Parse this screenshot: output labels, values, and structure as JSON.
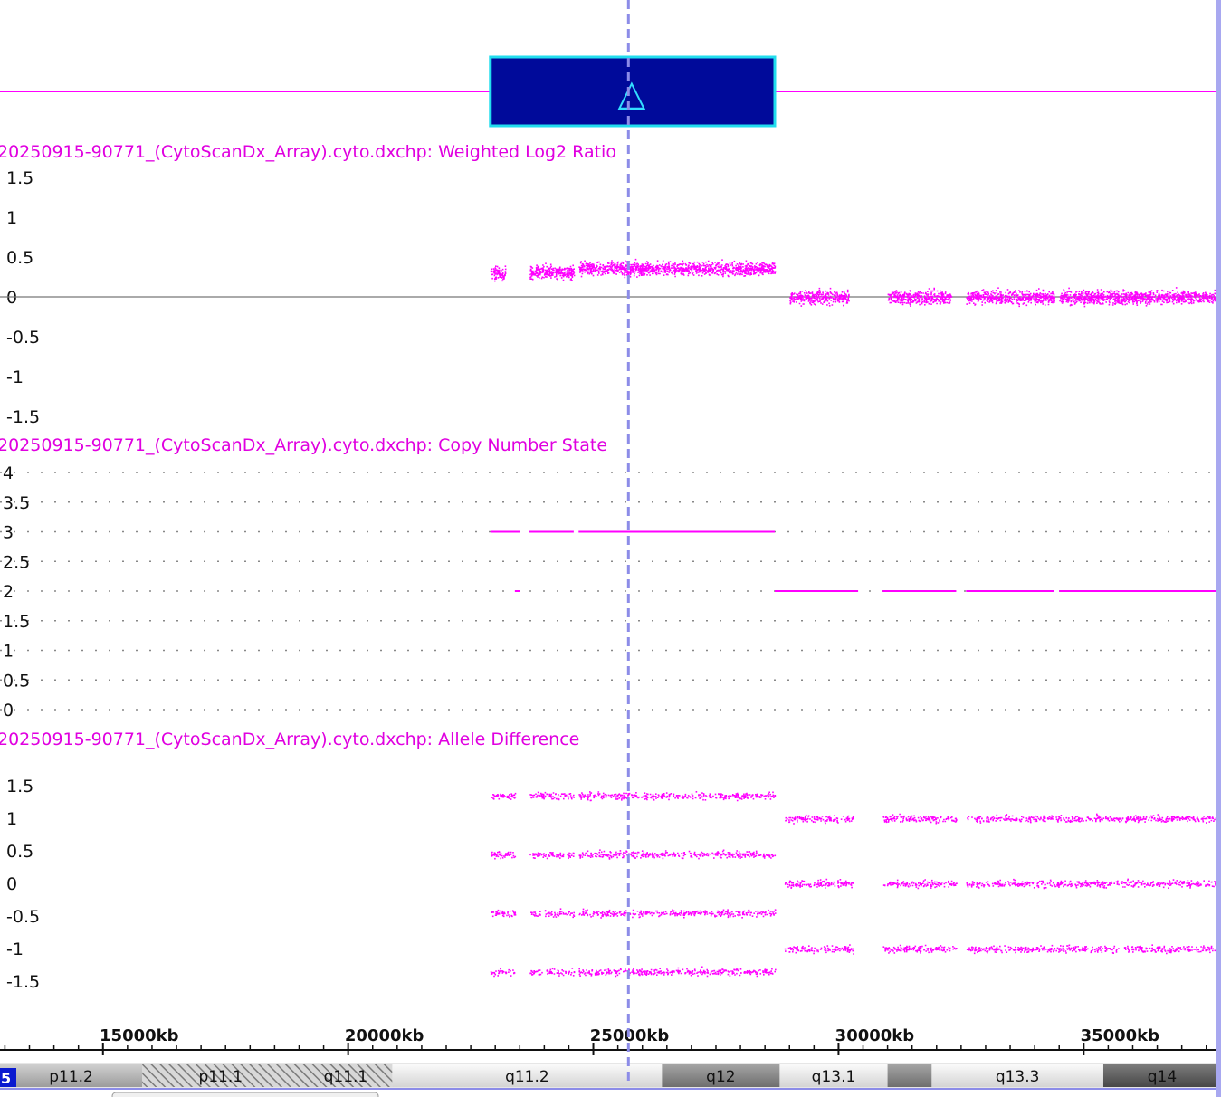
{
  "colors": {
    "data": "#ff00ff",
    "title": "#e000e0",
    "segment": "#000a9a",
    "segment_border": "#22ddee",
    "cursor": "#8c8ce8",
    "right_border": "#a8a8f0",
    "chrom_tag": "#0a1ad0"
  },
  "icons": {
    "segment_marker": "triangle-up-icon"
  },
  "segment": {
    "marker": "△",
    "start_kb": 22900,
    "end_kb": 28700,
    "state": "gain"
  },
  "cursor_kb": 25900,
  "chromosome_tag": "5",
  "chart_data": [
    {
      "type": "scatter",
      "title": "20250915-90771_(CytoScanDx_Array).cyto.dxchp: Weighted Log2 Ratio",
      "ytick_labels": [
        "1.5",
        "1",
        "0.5",
        "0",
        "-0.5",
        "-1",
        "-1.5"
      ],
      "ylim": [
        -1.5,
        1.5
      ],
      "zero_line": true,
      "series_description_kb_ranges": [
        {
          "x_start_kb": 22900,
          "x_end_kb": 23200,
          "mean": 0.3
        },
        {
          "x_start_kb": 23700,
          "x_end_kb": 24600,
          "mean": 0.32
        },
        {
          "x_start_kb": 24700,
          "x_end_kb": 28700,
          "mean": 0.36
        },
        {
          "x_start_kb": 29000,
          "x_end_kb": 30200,
          "mean": 0.0
        },
        {
          "x_start_kb": 31000,
          "x_end_kb": 32300,
          "mean": 0.0
        },
        {
          "x_start_kb": 32600,
          "x_end_kb": 34400,
          "mean": 0.0
        },
        {
          "x_start_kb": 34500,
          "x_end_kb": 37700,
          "mean": 0.0
        }
      ]
    },
    {
      "type": "line",
      "title": "20250915-90771_(CytoScanDx_Array).cyto.dxchp: Copy Number State",
      "ytick_labels": [
        "4",
        "3.5",
        "3",
        "2.5",
        "2",
        "1.5",
        "1",
        "0.5",
        "0"
      ],
      "ylim": [
        0,
        4
      ],
      "grid": true,
      "segments": [
        {
          "x_start_kb": 22900,
          "x_end_kb": 23500,
          "value": 3
        },
        {
          "x_start_kb": 23700,
          "x_end_kb": 24600,
          "value": 3
        },
        {
          "x_start_kb": 24700,
          "x_end_kb": 28700,
          "value": 3
        },
        {
          "x_start_kb": 23400,
          "x_end_kb": 23500,
          "value": 2
        },
        {
          "x_start_kb": 28700,
          "x_end_kb": 30400,
          "value": 2
        },
        {
          "x_start_kb": 30900,
          "x_end_kb": 32400,
          "value": 2
        },
        {
          "x_start_kb": 32600,
          "x_end_kb": 34400,
          "value": 2
        },
        {
          "x_start_kb": 34500,
          "x_end_kb": 37700,
          "value": 2
        }
      ]
    },
    {
      "type": "scatter",
      "title": "20250915-90771_(CytoScanDx_Array).cyto.dxchp: Allele Difference",
      "ytick_labels": [
        "1.5",
        "1",
        "0.5",
        "0",
        "-0.5",
        "-1",
        "-1.5"
      ],
      "ylim": [
        -1.7,
        1.7
      ],
      "bands_gain_region": {
        "x_start_kb": 22900,
        "x_end_kb": 28700,
        "levels": [
          1.35,
          0.45,
          -0.45,
          -1.35
        ]
      },
      "bands_normal_region": {
        "x_start_kb": 28900,
        "x_end_kb": 37700,
        "levels": [
          1.0,
          0.0,
          -1.0
        ]
      },
      "gaps_kb": [
        [
          23400,
          23700
        ],
        [
          24600,
          24700
        ],
        [
          30300,
          30900
        ],
        [
          32400,
          32600
        ]
      ]
    }
  ],
  "x_axis": {
    "range_kb": [
      12900,
      37800
    ],
    "tick_labels": [
      "15000kb",
      "20000kb",
      "25000kb",
      "30000kb",
      "35000kb"
    ],
    "tick_values_kb": [
      15000,
      20000,
      25000,
      30000,
      35000
    ],
    "minor_step_kb": 500
  },
  "ideogram": {
    "bands": [
      {
        "name": "p11.2",
        "start_kb": 12900,
        "end_kb": 15800,
        "stain": "gpos25"
      },
      {
        "name": "p11.1",
        "start_kb": 15800,
        "end_kb": 19000,
        "stain": "acen"
      },
      {
        "name": "q11.1",
        "start_kb": 19000,
        "end_kb": 20900,
        "stain": "acen"
      },
      {
        "name": "q11.2",
        "start_kb": 20900,
        "end_kb": 26400,
        "stain": "gneg"
      },
      {
        "name": "q12",
        "start_kb": 26400,
        "end_kb": 28800,
        "stain": "gpos50"
      },
      {
        "name": "q13.1",
        "start_kb": 28800,
        "end_kb": 31000,
        "stain": "gneg"
      },
      {
        "name": "",
        "start_kb": 31000,
        "end_kb": 31900,
        "stain": "gpos50"
      },
      {
        "name": "q13.3",
        "start_kb": 31900,
        "end_kb": 35400,
        "stain": "gneg"
      },
      {
        "name": "q14",
        "start_kb": 35400,
        "end_kb": 39800,
        "stain": "gpos75"
      }
    ]
  }
}
